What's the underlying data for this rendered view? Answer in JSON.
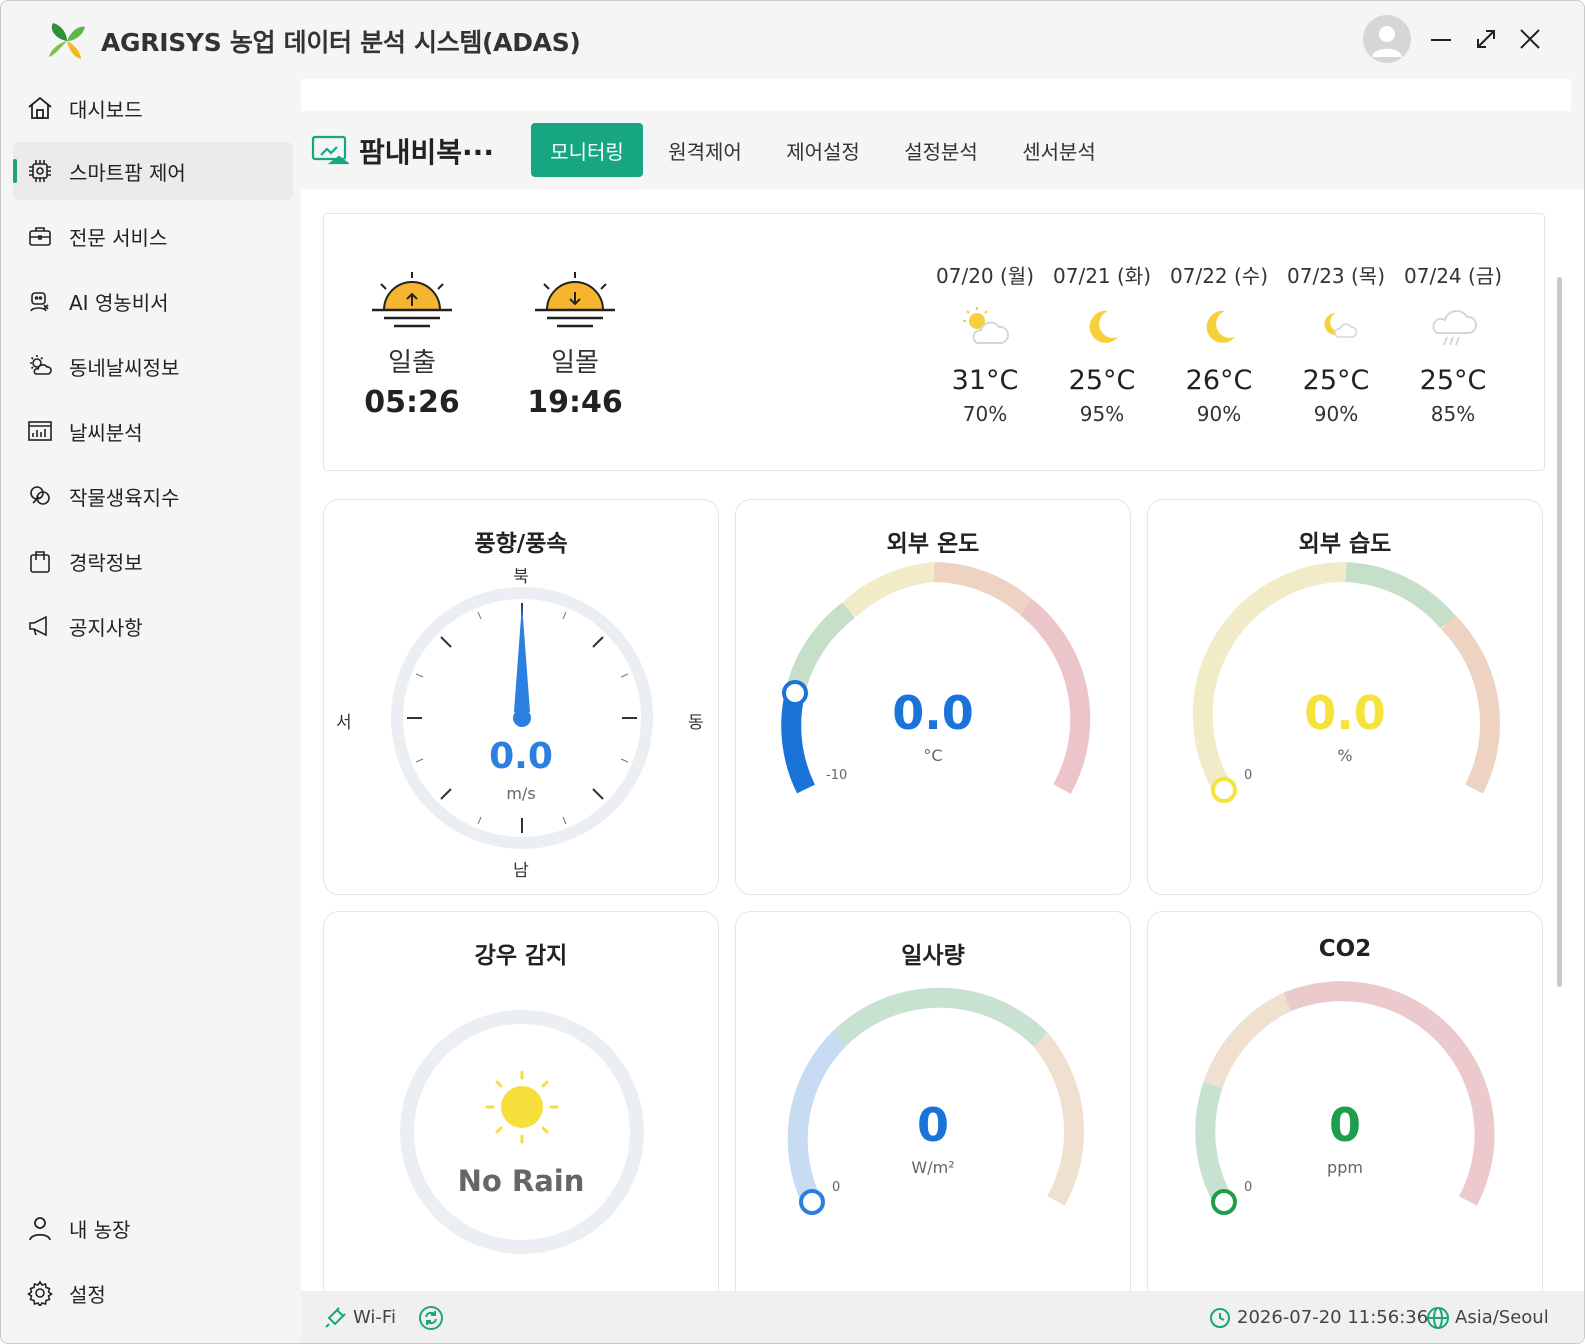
{
  "app": {
    "title": "AGRISYS 농업 데이터 분석 시스템(ADAS)"
  },
  "sidebar": {
    "items": [
      {
        "label": "대시보드"
      },
      {
        "label": "스마트팜 제어"
      },
      {
        "label": "전문 서비스"
      },
      {
        "label": "AI 영농비서"
      },
      {
        "label": "동네날씨정보"
      },
      {
        "label": "날씨분석"
      },
      {
        "label": "작물생육지수"
      },
      {
        "label": "경락정보"
      },
      {
        "label": "공지사항"
      }
    ],
    "bottom": [
      {
        "label": "내 농장"
      },
      {
        "label": "설정"
      }
    ],
    "active_index": 1
  },
  "header": {
    "farm_name": "팜내비복···",
    "tabs": [
      {
        "label": "모니터링",
        "active": true
      },
      {
        "label": "원격제어"
      },
      {
        "label": "제어설정"
      },
      {
        "label": "설정분석"
      },
      {
        "label": "센서분석"
      }
    ],
    "accent_color": "#17a682"
  },
  "weather": {
    "sunrise": {
      "label": "일출",
      "time": "05:26"
    },
    "sunset": {
      "label": "일몰",
      "time": "19:46"
    },
    "forecast": [
      {
        "date": "07/20 (월)",
        "icon": "partly-cloudy-sun-icon",
        "temp": "31°C",
        "humidity": "70%"
      },
      {
        "date": "07/21 (화)",
        "icon": "moon-icon",
        "temp": "25°C",
        "humidity": "95%"
      },
      {
        "date": "07/22 (수)",
        "icon": "moon-icon",
        "temp": "26°C",
        "humidity": "90%"
      },
      {
        "date": "07/23 (목)",
        "icon": "partly-cloudy-moon-icon",
        "temp": "25°C",
        "humidity": "90%"
      },
      {
        "date": "07/24 (금)",
        "icon": "rain-cloud-icon",
        "temp": "25°C",
        "humidity": "85%"
      }
    ]
  },
  "gauges": {
    "wind": {
      "title": "풍향/풍속",
      "value": "0.0",
      "unit": "m/s",
      "north": "북",
      "south": "남",
      "east": "동",
      "west": "서"
    },
    "temperature": {
      "title": "외부 온도",
      "value": "0.0",
      "unit": "°C",
      "min": "-10",
      "color": "#1a73d9"
    },
    "humidity": {
      "title": "외부 습도",
      "value": "0.0",
      "unit": "%",
      "min": "0",
      "color": "#f5e23a"
    },
    "rain": {
      "title": "강우 감지",
      "status": "No Rain"
    },
    "solar": {
      "title": "일사량",
      "value": "0",
      "unit": "W/m²",
      "min": "0",
      "color": "#1a73d9"
    },
    "co2": {
      "title": "CO2",
      "value": "0",
      "unit": "ppm",
      "min": "0",
      "color": "#1e9e4a"
    }
  },
  "status": {
    "connection": "Wi-Fi",
    "datetime": "2026-07-20 11:56:36",
    "timezone": "Asia/Seoul"
  }
}
